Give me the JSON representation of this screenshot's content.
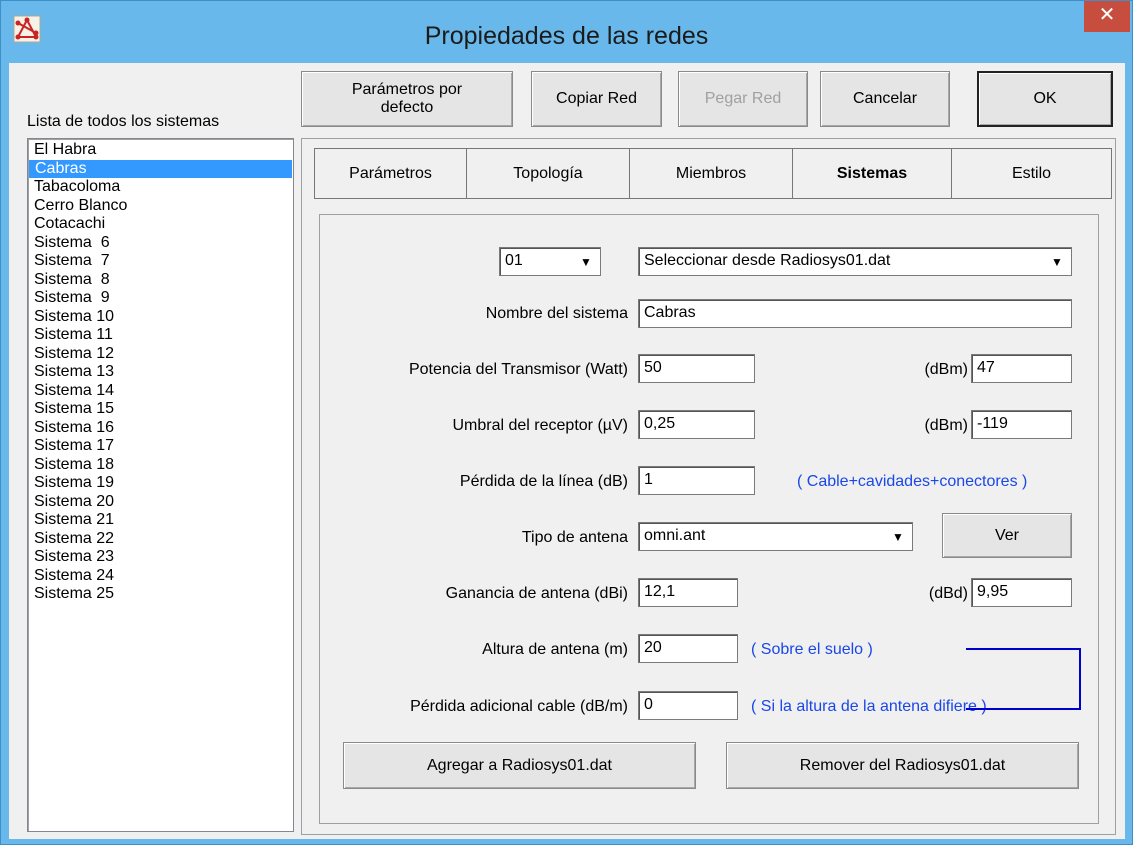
{
  "window": {
    "title": "Propiedades de las redes",
    "close_glyph": "✕"
  },
  "list": {
    "label": "Lista de todos los sistemas",
    "selected_index": 1,
    "items": [
      "El Habra",
      "Cabras",
      "Tabacoloma",
      "Cerro Blanco",
      "Cotacachi",
      "Sistema  6",
      "Sistema  7",
      "Sistema  8",
      "Sistema  9",
      "Sistema 10",
      "Sistema 11",
      "Sistema 12",
      "Sistema 13",
      "Sistema 14",
      "Sistema 15",
      "Sistema 16",
      "Sistema 17",
      "Sistema 18",
      "Sistema 19",
      "Sistema 20",
      "Sistema 21",
      "Sistema 22",
      "Sistema 23",
      "Sistema 24",
      "Sistema 25"
    ]
  },
  "toolbar": {
    "defaults_line1": "Parámetros por",
    "defaults_line2": "defecto",
    "copy": "Copiar Red",
    "paste": "Pegar Red",
    "cancel": "Cancelar",
    "ok": "OK"
  },
  "tabs": {
    "parametros": "Parámetros",
    "topologia": "Topología",
    "miembros": "Miembros",
    "sistemas": "Sistemas",
    "estilo": "Estilo",
    "active": "sistemas"
  },
  "form": {
    "system_number": "01",
    "select_from": "Seleccionar desde Radiosys01.dat",
    "name_label": "Nombre del sistema",
    "name_value": "Cabras",
    "power_label": "Potencia del Transmisor (Watt)",
    "power_value": "50",
    "power_dbm_label": "(dBm)",
    "power_dbm_value": "47",
    "threshold_label": "Umbral del receptor (µV)",
    "threshold_value": "0,25",
    "threshold_dbm_label": "(dBm)",
    "threshold_dbm_value": "-119",
    "loss_label": "Pérdida de la línea (dB)",
    "loss_value": "1",
    "loss_note": "( Cable+cavidades+conectores )",
    "antenna_type_label": "Tipo de antena",
    "antenna_type_value": "omni.ant",
    "view_button": "Ver",
    "gain_label": "Ganancia de antena (dBi)",
    "gain_value": "12,1",
    "gain_dbd_label": "(dBd)",
    "gain_dbd_value": "9,95",
    "height_label": "Altura de antena (m)",
    "height_value": "20",
    "height_note": "( Sobre el suelo )",
    "extra_loss_label": "Pérdida adicional cable (dB/m)",
    "extra_loss_value": "0",
    "extra_loss_note": "( Si la altura de la antena difiere )",
    "add_button": "Agregar a Radiosys01.dat",
    "remove_button": "Remover del Radiosys01.dat"
  },
  "colors": {
    "titlebar": "#69b8ec",
    "close": "#c74d3f",
    "selection": "#3399ff",
    "note_text": "#1a47e8",
    "bracket": "#0000cc"
  }
}
